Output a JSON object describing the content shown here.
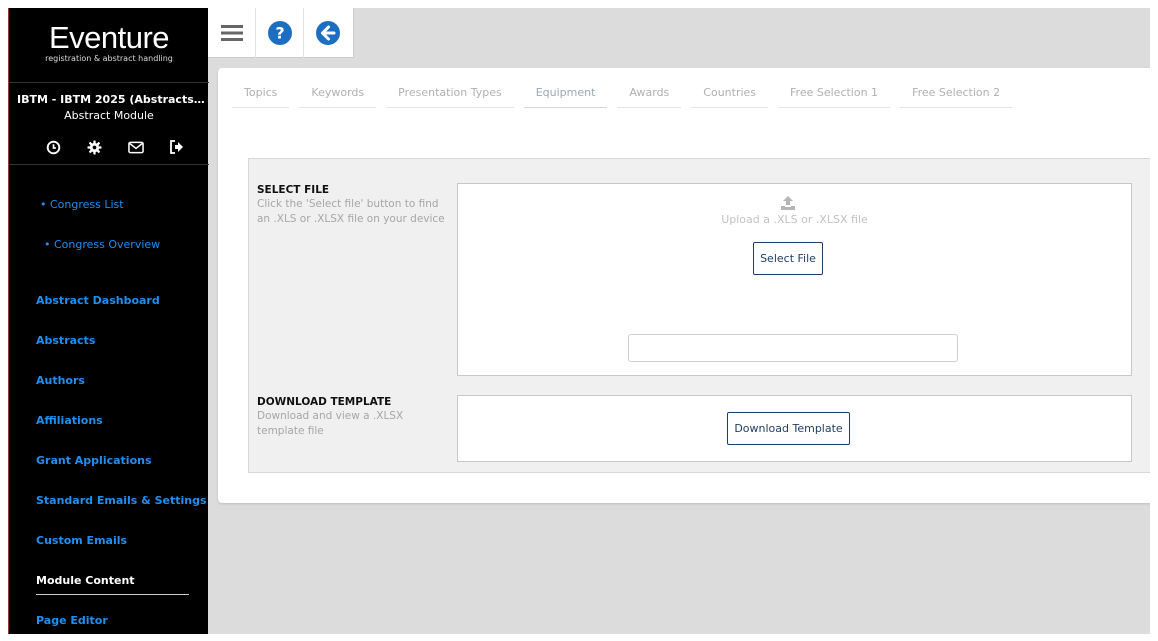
{
  "sidebar": {
    "logo_title": "Eventure",
    "logo_subtitle": "registration & abstract handling",
    "congress_title": "IBTM - IBTM 2025 (Abstracts & Partnerships)",
    "module_title": "Abstract Module",
    "icons": [
      "clock-icon",
      "gear-icon",
      "envelope-icon",
      "sign-out-icon"
    ],
    "links": {
      "congress_list": "• Congress List",
      "congress_overview": "• Congress Overview"
    },
    "nav": [
      "Abstract Dashboard",
      "Abstracts",
      "Authors",
      "Affiliations",
      "Grant Applications",
      "Standard Emails & Settings",
      "Custom Emails",
      "Module Content",
      "Page Editor"
    ],
    "active_item": "Module Content"
  },
  "toolbar": {
    "buttons": [
      "menu-icon",
      "help-icon",
      "back-icon"
    ]
  },
  "tabs": [
    "Topics",
    "Keywords",
    "Presentation Types",
    "Equipment",
    "Awards",
    "Countries",
    "Free Selection 1",
    "Free Selection 2"
  ],
  "active_tab": "Equipment",
  "select_file": {
    "title": "SELECT FILE",
    "description": "Click the 'Select file' button to find an .XLS or .XLSX file on your device",
    "hint": "Upload a .XLS or .XLSX file",
    "button_label": "Select File",
    "filename_value": ""
  },
  "download_template": {
    "title": "DOWNLOAD TEMPLATE",
    "description": "Download and view a .XLSX template file",
    "button_label": "Download Template"
  },
  "colors": {
    "sidebar_bg": "#000000",
    "link_blue": "#1e8ff5",
    "toolbar_blue": "#1b6ec2",
    "button_border": "#1f3f66"
  }
}
